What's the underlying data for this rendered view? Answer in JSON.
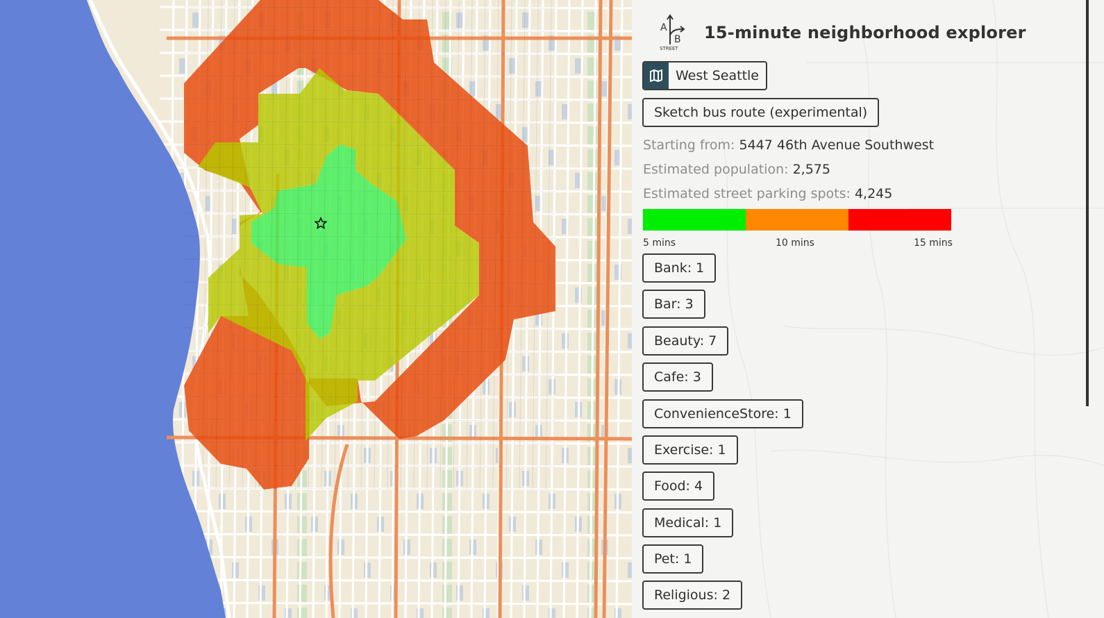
{
  "app": {
    "title": "15-minute neighborhood explorer",
    "logo_letters": [
      "A",
      "B"
    ],
    "logo_subtext": "STREET"
  },
  "region_button": {
    "label": "West Seattle",
    "icon": "map-icon"
  },
  "sketch_button": {
    "label": "Sketch bus route (experimental)"
  },
  "info": {
    "start": {
      "label": "Starting from:",
      "value": "5447 46th Avenue Southwest"
    },
    "population": {
      "label": "Estimated population:",
      "value": "2,575"
    },
    "parking": {
      "label": "Estimated street parking spots:",
      "value": "4,245"
    }
  },
  "legend": {
    "colors": [
      "#00ee00",
      "#ff8800",
      "#ff0000"
    ],
    "labels": [
      "5 mins",
      "10 mins",
      "15 mins"
    ]
  },
  "amenities": [
    "Bank: 1",
    "Bar: 3",
    "Beauty: 7",
    "Cafe: 3",
    "ConvenienceStore: 1",
    "Exercise: 1",
    "Food: 4",
    "Medical: 1",
    "Pet: 1",
    "Religious: 2"
  ],
  "map": {
    "marker_icon": "star-icon",
    "colors": {
      "water": "#6381d6",
      "land": "#f1ead8",
      "arterial": "#ec8f5a",
      "zone_15": "#e84e10",
      "zone_10": "#b7c800",
      "zone_5": "#44ef58"
    }
  }
}
